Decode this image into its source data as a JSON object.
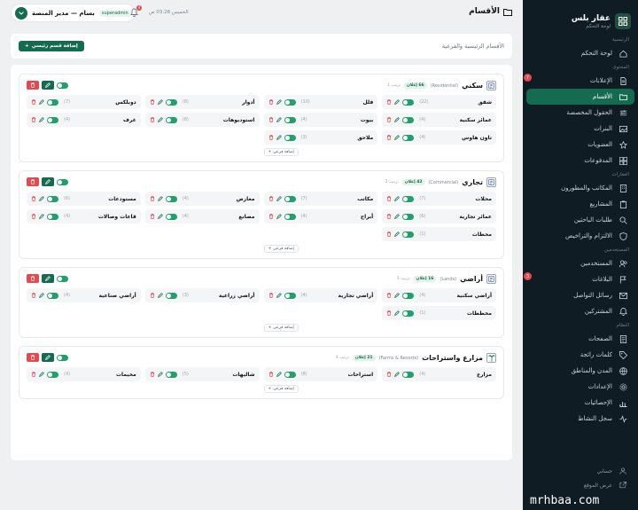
{
  "brand": {
    "name": "عقار بلس",
    "subtitle": "لوحة التحكم"
  },
  "sidebar": {
    "sections": [
      {
        "title": "الرئيسية",
        "items": [
          {
            "label": "لوحة التحكم",
            "icon": "home-icon"
          }
        ]
      },
      {
        "title": "المحتوى",
        "items": [
          {
            "label": "الإعلانات",
            "icon": "document-icon",
            "badge": "7"
          },
          {
            "label": "الأقسام",
            "icon": "folder-icon",
            "active": true
          },
          {
            "label": "الحقول المخصصة",
            "icon": "sliders-icon"
          },
          {
            "label": "البنرات",
            "icon": "image-icon"
          },
          {
            "label": "العضويات",
            "icon": "star-icon"
          },
          {
            "label": "المدفوعات",
            "icon": "grid-icon"
          }
        ]
      },
      {
        "title": "العقارات",
        "items": [
          {
            "label": "المكاتب والمطورون",
            "icon": "building-icon"
          },
          {
            "label": "المشاريع",
            "icon": "clipboard-icon"
          },
          {
            "label": "طلبات الباحثين",
            "icon": "search-icon"
          },
          {
            "label": "الالتزام والتراخيص",
            "icon": "shield-icon"
          }
        ]
      },
      {
        "title": "المستخدمين",
        "items": [
          {
            "label": "المستخدمين",
            "icon": "users-icon"
          },
          {
            "label": "البلاغات",
            "icon": "flag-icon",
            "badge": "3"
          },
          {
            "label": "رسائل التواصل",
            "icon": "mail-icon"
          },
          {
            "label": "المشتركين",
            "icon": "bell-icon"
          }
        ]
      },
      {
        "title": "النظام",
        "items": [
          {
            "label": "الصفحات",
            "icon": "page-icon"
          },
          {
            "label": "كلمات رائجة",
            "icon": "tag-icon"
          },
          {
            "label": "المدن والمناطق",
            "icon": "globe-icon"
          },
          {
            "label": "الإعدادات",
            "icon": "gear-icon"
          },
          {
            "label": "الإحصائيات",
            "icon": "chart-icon"
          },
          {
            "label": "سجل النشاط",
            "icon": "activity-icon"
          }
        ]
      }
    ],
    "bottom": [
      {
        "label": "حسابي",
        "icon": "user-icon"
      },
      {
        "label": "عرض الموقع",
        "icon": "external-icon"
      }
    ]
  },
  "watermark": "mrhbaa.com",
  "topbar": {
    "title": "الأقسام",
    "datetime": "الخميس 03:26 ص",
    "bell_badge": "4",
    "user_name": "بسام — مدير المنصة",
    "user_role": "superadmin"
  },
  "header": {
    "description": "الأقسام الرئيسية والفرعية",
    "add_button": "إضافة قسم رئيسي"
  },
  "categories": [
    {
      "name": "سكني",
      "en": "(Residential)",
      "count": "66 إعلان",
      "order": "ترتيب 1",
      "subs": [
        {
          "name": "شقق",
          "count": "(22)"
        },
        {
          "name": "فلل",
          "count": "(10)"
        },
        {
          "name": "أدوار",
          "count": "(8)"
        },
        {
          "name": "دوبلكس",
          "count": "(7)"
        },
        {
          "name": "عمائر سكنية",
          "count": "(4)"
        },
        {
          "name": "بيوت",
          "count": "(4)"
        },
        {
          "name": "استوديوهات",
          "count": "(8)"
        },
        {
          "name": "غرف",
          "count": "(4)"
        },
        {
          "name": "تاون هاوس",
          "count": "(4)"
        },
        {
          "name": "ملاحق",
          "count": "(3)"
        }
      ],
      "add_sub": "إضافة فرعي"
    },
    {
      "name": "تجاري",
      "en": "(Commercial)",
      "count": "42 إعلان",
      "order": "ترتيب 2",
      "subs": [
        {
          "name": "محلات",
          "count": "(7)"
        },
        {
          "name": "مكاتب",
          "count": "(7)"
        },
        {
          "name": "معارض",
          "count": "(4)"
        },
        {
          "name": "مستودعات",
          "count": "(6)"
        },
        {
          "name": "عمائر تجارية",
          "count": "(6)"
        },
        {
          "name": "أبراج",
          "count": "(4)"
        },
        {
          "name": "مصانع",
          "count": "(4)"
        },
        {
          "name": "قاعات وصالات",
          "count": "(4)"
        },
        {
          "name": "محطات",
          "count": "(1)"
        }
      ],
      "add_sub": "إضافة فرعي"
    },
    {
      "name": "أراضي",
      "en": "(Lands)",
      "count": "16 إعلان",
      "order": "ترتيب 3",
      "subs": [
        {
          "name": "أراضي سكنية",
          "count": "(4)"
        },
        {
          "name": "أراضي تجارية",
          "count": "(4)"
        },
        {
          "name": "أراضي زراعية",
          "count": "(3)"
        },
        {
          "name": "أراضي صناعية",
          "count": "(4)"
        },
        {
          "name": "مخططات",
          "count": "(1)"
        }
      ],
      "add_sub": "إضافة فرعي"
    },
    {
      "name": "مزارع واستراحات",
      "en": "(Farms & Resorts)",
      "count": "21 إعلان",
      "order": "ترتيب 4",
      "subs": [
        {
          "name": "مزارع",
          "count": "(4)"
        },
        {
          "name": "استراحات",
          "count": "(8)"
        },
        {
          "name": "شاليهات",
          "count": "(5)"
        },
        {
          "name": "مخيمات",
          "count": "(4)"
        }
      ],
      "add_sub": "إضافة فرعي"
    }
  ],
  "colors": {
    "accent": "#156b4f",
    "sidebar_bg": "#0f1c24",
    "danger": "#e5484d",
    "toggle_on": "#22a06b"
  }
}
